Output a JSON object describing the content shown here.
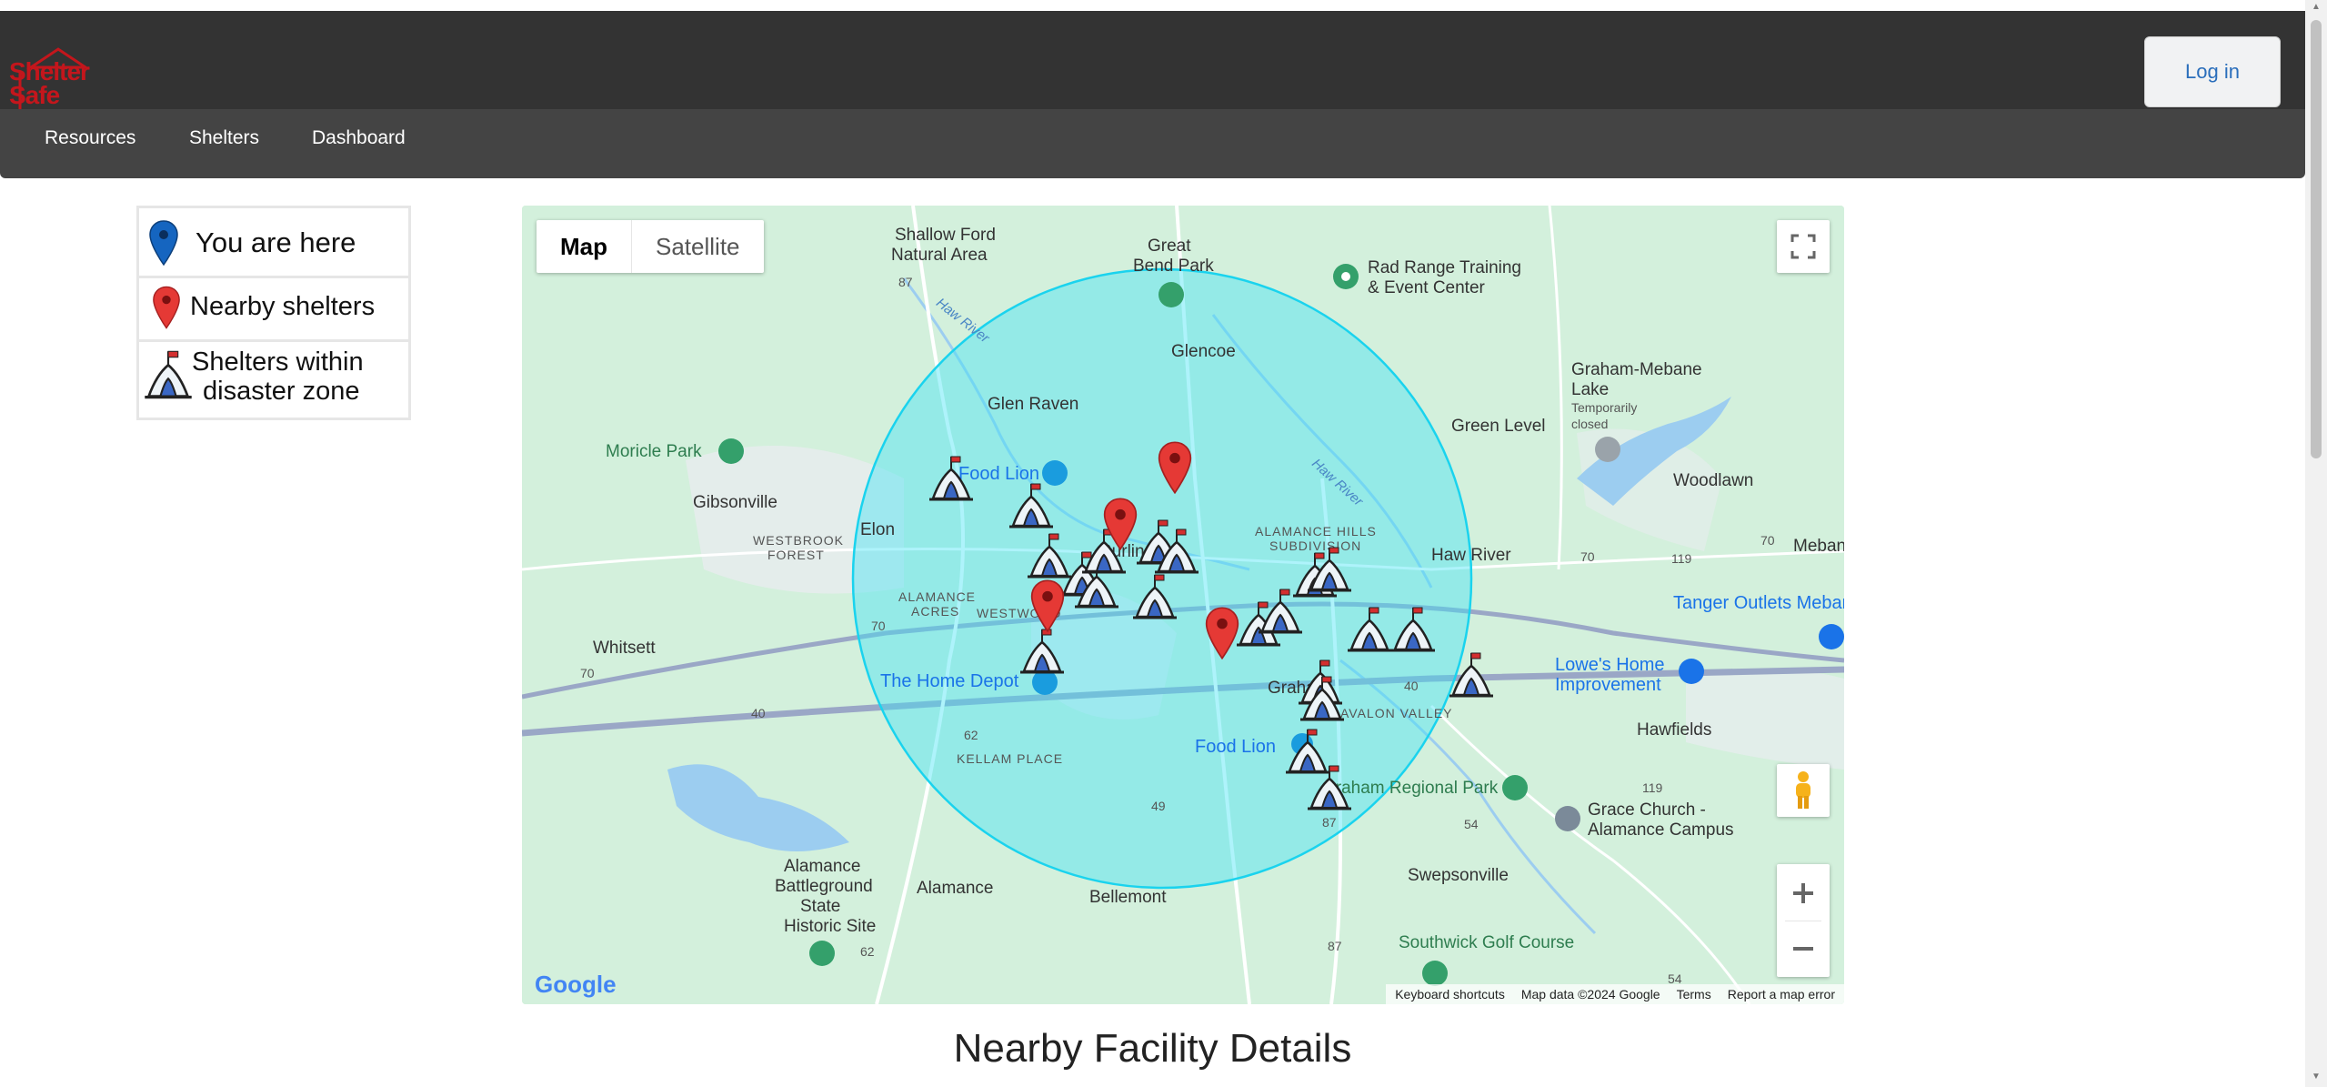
{
  "app": {
    "logo_text": "Shelter Safe"
  },
  "header": {
    "login_label": "Log in"
  },
  "nav": {
    "items": [
      {
        "label": "Resources"
      },
      {
        "label": "Shelters"
      },
      {
        "label": "Dashboard"
      }
    ]
  },
  "legend": {
    "you_are_here": "You are here",
    "nearby_shelters": "Nearby shelters",
    "shelters_disaster_zone_line1": "Shelters within",
    "shelters_disaster_zone_line2": "disaster zone"
  },
  "map": {
    "type_map": "Map",
    "type_satellite": "Satellite",
    "places": {
      "shallow_ford_1": "Shallow Ford",
      "shallow_ford_2": "Natural Area",
      "great_bend_1": "Great",
      "great_bend_2": "Bend Park",
      "rad_range_1": "Rad Range Training",
      "rad_range_2": "& Event Center",
      "glencoe": "Glencoe",
      "graham_mebane_1": "Graham-Mebane",
      "graham_mebane_2": "Lake",
      "graham_mebane_3": "Temporarily",
      "graham_mebane_4": "closed",
      "glen_raven": "Glen Raven",
      "green_level": "Green Level",
      "moricle_park": "Moricle Park",
      "woodlawn": "Woodlawn",
      "food_lion_1": "Food Lion",
      "gibsonville": "Gibsonville",
      "elon": "Elon",
      "westbrook_1": "WESTBROOK",
      "westbrook_2": "FOREST",
      "burlington": "Burlington",
      "alamance_hills_1": "ALAMANCE HILLS",
      "alamance_hills_2": "SUBDIVISION",
      "haw_river": "Haw River",
      "mebane": "Mebane",
      "tanger": "Tanger Outlets Mebane",
      "alamance_acres_1": "ALAMANCE",
      "alamance_acres_2": "ACRES",
      "westwood": "WESTWOOD",
      "whitsett": "Whitsett",
      "lowes_1": "Lowe's Home",
      "lowes_2": "Improvement",
      "home_depot": "The Home Depot",
      "graham": "Graham",
      "avalon_valley": "AVALON VALLEY",
      "hawfields": "Hawfields",
      "food_lion_2": "Food Lion",
      "kellam_place": "KELLAM PLACE",
      "graham_regional_park": "Graham Regional Park",
      "grace_church_1": "Grace Church -",
      "grace_church_2": "Alamance Campus",
      "alamance_battleground_1": "Alamance",
      "alamance_battleground_2": "Battleground",
      "alamance_battleground_3": "State",
      "alamance_battleground_4": "Historic Site",
      "alamance": "Alamance",
      "bellemont": "Bellemont",
      "swepsonville": "Swepsonville",
      "southwick": "Southwick Golf Course",
      "haw_river_water_1": "Haw River",
      "haw_river_water_2": "Haw River"
    },
    "route_labels": [
      "87",
      "70",
      "70",
      "70",
      "119",
      "70",
      "119",
      "62",
      "49",
      "87",
      "54",
      "87",
      "62",
      "54",
      "40",
      "40"
    ],
    "attribution": {
      "keyboard": "Keyboard shortcuts",
      "mapdata": "Map data ©2024 Google",
      "terms": "Terms",
      "report": "Report a map error"
    },
    "google_logo": "Google"
  },
  "section": {
    "title": "Nearby Facility Details"
  },
  "colors": {
    "header": "#333333",
    "nav": "#444444",
    "circle": "#4fe3f0",
    "marker_red": "#e53935",
    "marker_blue": "#1565c0",
    "brand": "#c4161c"
  }
}
